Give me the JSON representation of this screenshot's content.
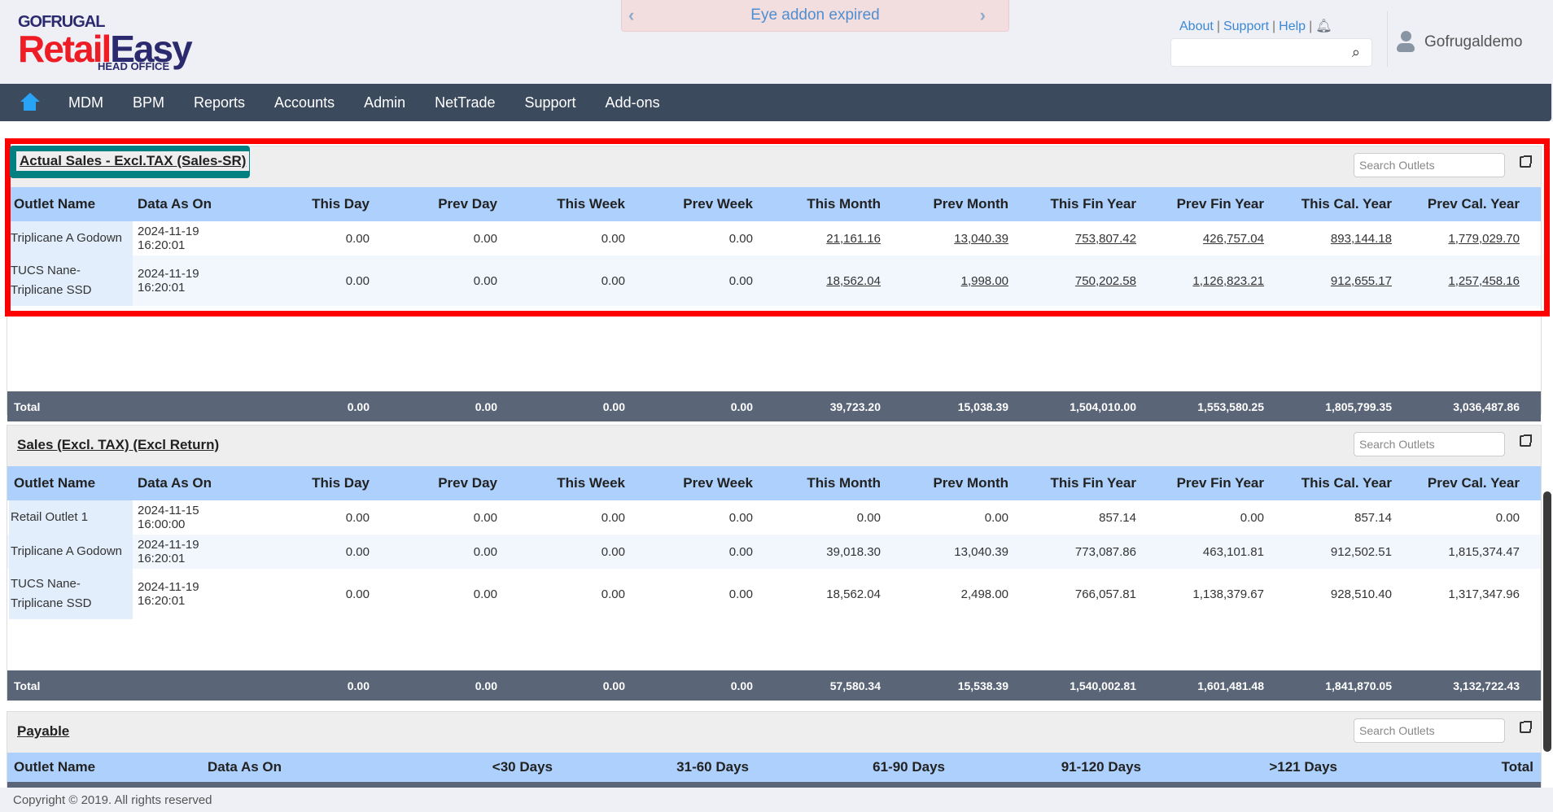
{
  "header": {
    "brand_top": "GOFRUGAL",
    "brand_main_1": "Retail",
    "brand_main_2": "Easy",
    "brand_sub": "HEAD OFFICE",
    "banner": "Eye addon expired",
    "links": [
      "About",
      "Support",
      "Help"
    ],
    "user": "Gofrugaldemo"
  },
  "nav": [
    "MDM",
    "BPM",
    "Reports",
    "Accounts",
    "Admin",
    "NetTrade",
    "Support",
    "Add-ons"
  ],
  "search_placeholder": "Search Outlets",
  "columns": [
    "Outlet Name",
    "Data As On",
    "This Day",
    "Prev Day",
    "This Week",
    "Prev Week",
    "This Month",
    "Prev Month",
    "This Fin Year",
    "Prev Fin Year",
    "This Cal. Year",
    "Prev Cal. Year"
  ],
  "panels": [
    {
      "title": "Actual Sales - Excl.TAX (Sales-SR)",
      "linked": true,
      "rows": [
        [
          "Triplicane A Godown",
          "2024-11-19 16:20:01",
          "0.00",
          "0.00",
          "0.00",
          "0.00",
          "21,161.16",
          "13,040.39",
          "753,807.42",
          "426,757.04",
          "893,144.18",
          "1,779,029.70"
        ],
        [
          "TUCS Nane- Triplicane SSD",
          "2024-11-19 16:20:01",
          "0.00",
          "0.00",
          "0.00",
          "0.00",
          "18,562.04",
          "1,998.00",
          "750,202.58",
          "1,126,823.21",
          "912,655.17",
          "1,257,458.16"
        ]
      ],
      "total": [
        "Total",
        "",
        "0.00",
        "0.00",
        "0.00",
        "0.00",
        "39,723.20",
        "15,038.39",
        "1,504,010.00",
        "1,553,580.25",
        "1,805,799.35",
        "3,036,487.86"
      ]
    },
    {
      "title": "Sales (Excl. TAX) (Excl Return)",
      "linked": false,
      "rows": [
        [
          "Retail Outlet 1",
          "2024-11-15 16:00:00",
          "0.00",
          "0.00",
          "0.00",
          "0.00",
          "0.00",
          "0.00",
          "857.14",
          "0.00",
          "857.14",
          "0.00"
        ],
        [
          "Triplicane A Godown",
          "2024-11-19 16:20:01",
          "0.00",
          "0.00",
          "0.00",
          "0.00",
          "39,018.30",
          "13,040.39",
          "773,087.86",
          "463,101.81",
          "912,502.51",
          "1,815,374.47"
        ],
        [
          "TUCS Nane- Triplicane SSD",
          "2024-11-19 16:20:01",
          "0.00",
          "0.00",
          "0.00",
          "0.00",
          "18,562.04",
          "2,498.00",
          "766,057.81",
          "1,138,379.67",
          "928,510.40",
          "1,317,347.96"
        ]
      ],
      "total": [
        "Total",
        "",
        "0.00",
        "0.00",
        "0.00",
        "0.00",
        "57,580.34",
        "15,538.39",
        "1,540,002.81",
        "1,601,481.48",
        "1,841,870.05",
        "3,132,722.43"
      ]
    }
  ],
  "payable": {
    "title": "Payable",
    "columns": [
      "Outlet Name",
      "Data As On",
      "<30 Days",
      "31-60 Days",
      "61-90 Days",
      "91-120 Days",
      ">121 Days",
      "Total"
    ]
  },
  "footer": "Copyright © 2019. All rights reserved"
}
